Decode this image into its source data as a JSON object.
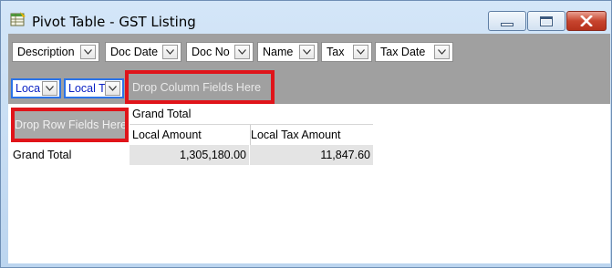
{
  "window": {
    "title": "Pivot Table - GST Listing",
    "icons": {
      "app": "spreadsheet-icon",
      "minimize": "minimize-icon",
      "maximize": "maximize-icon",
      "close": "close-icon"
    }
  },
  "filter_fields": [
    {
      "label": "Description"
    },
    {
      "label": "Doc Date"
    },
    {
      "label": "Doc No"
    },
    {
      "label": "Name"
    },
    {
      "label": "Tax"
    },
    {
      "label": "Tax Date"
    }
  ],
  "data_fields": [
    {
      "label": "Loca"
    },
    {
      "label": "Local T"
    }
  ],
  "drop_zones": {
    "column": "Drop Column Fields Here",
    "row": "Drop Row Fields Here"
  },
  "grid": {
    "column_grand_total": "Grand Total",
    "headers": [
      "Local Amount",
      "Local Tax Amount"
    ],
    "row_grand_total": "Grand Total",
    "values": [
      "1,305,180.00",
      "11,847.60"
    ]
  },
  "colors": {
    "highlight": "#e0141a",
    "data_field_border": "#2a73e8",
    "data_field_text": "#0b22c4"
  }
}
